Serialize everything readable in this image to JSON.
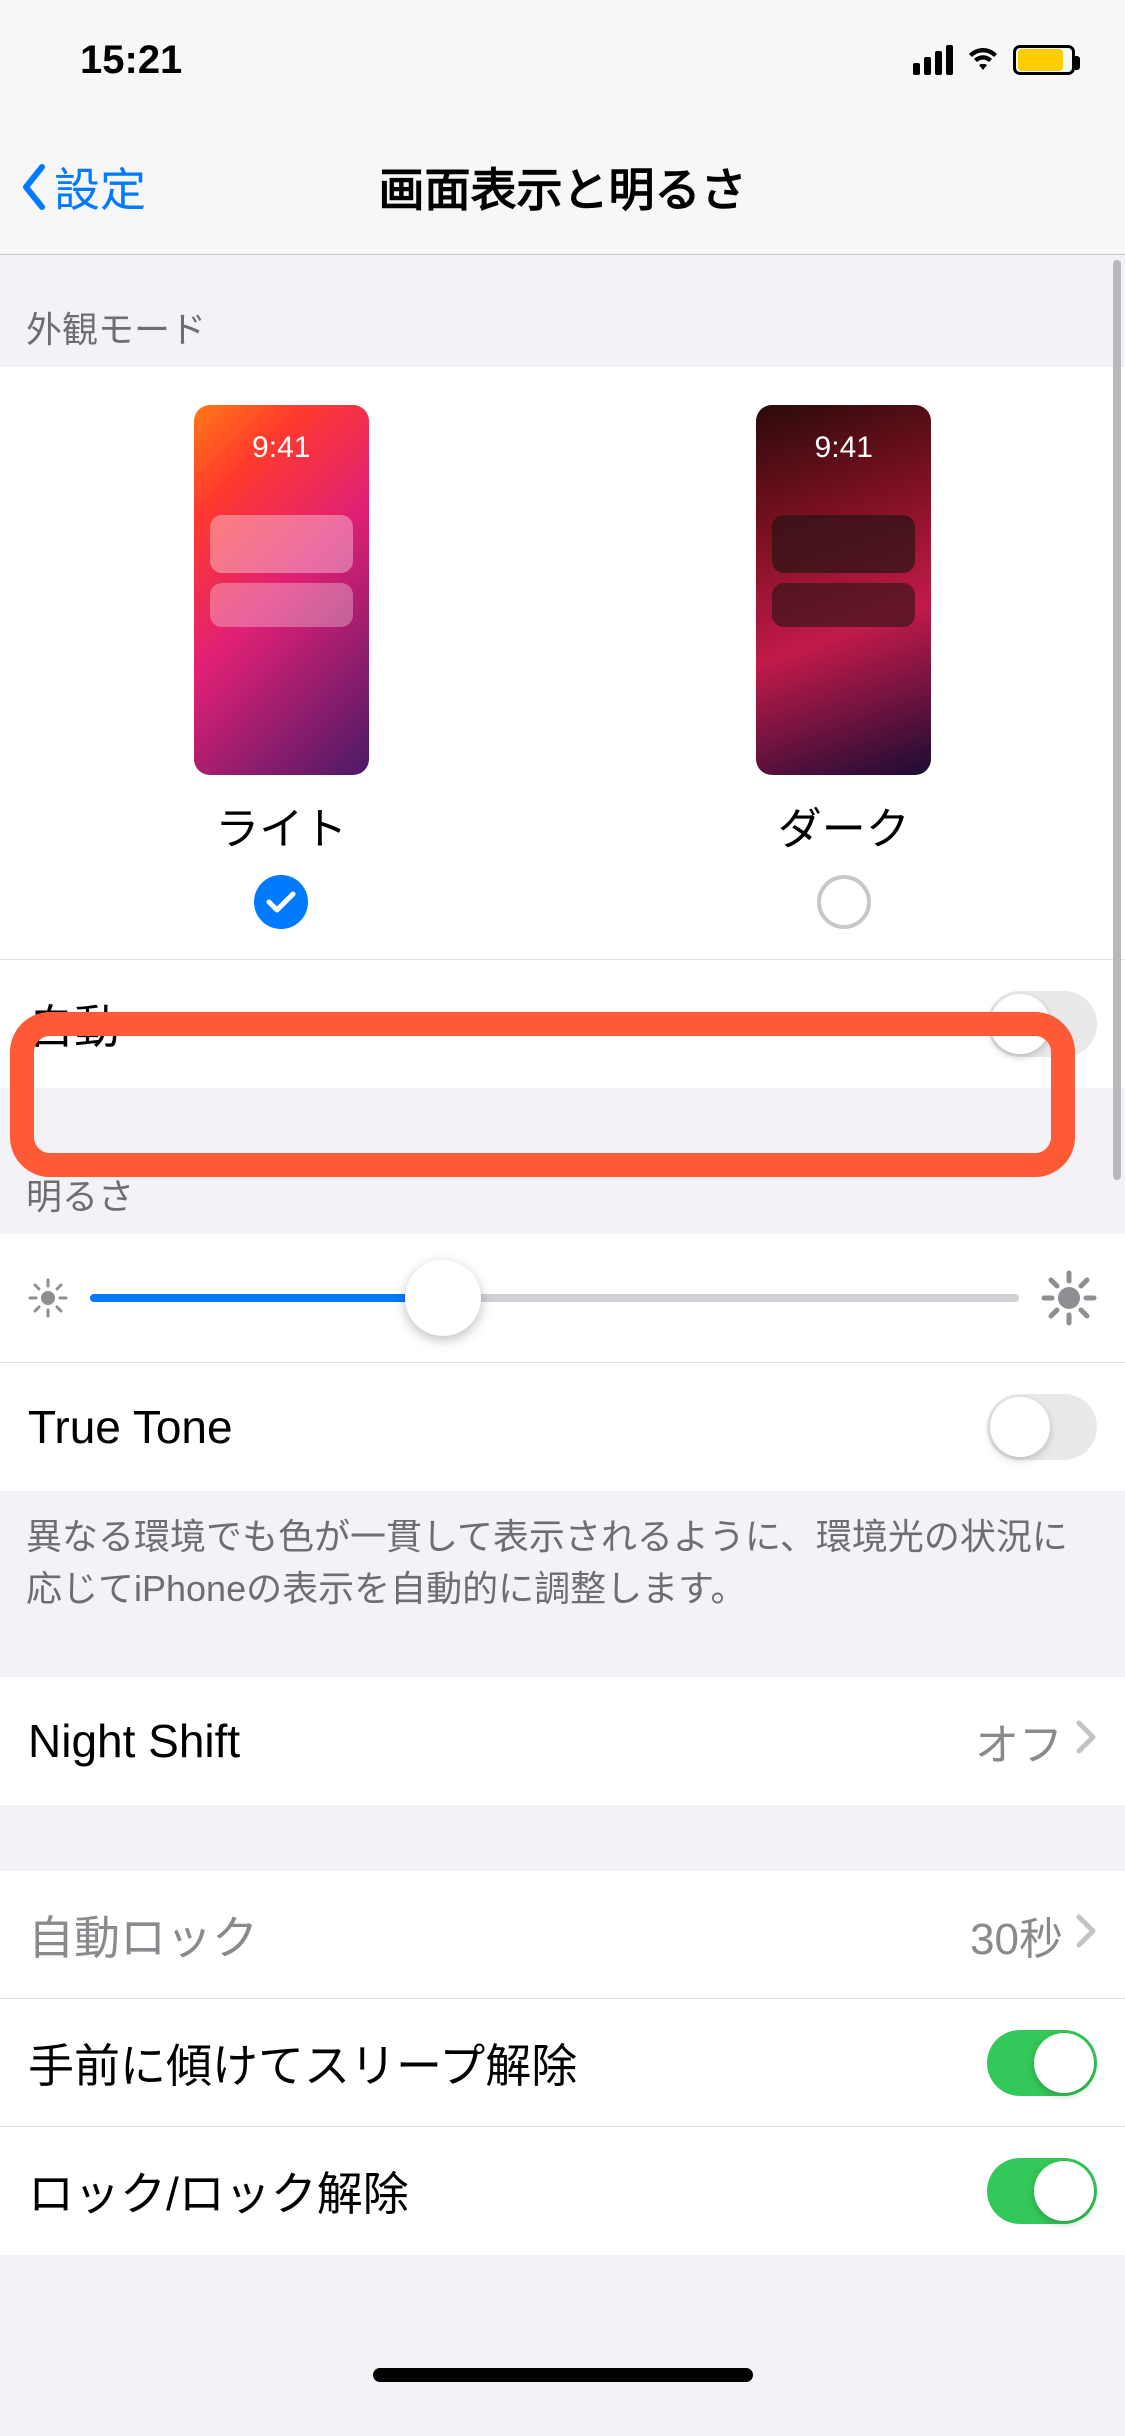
{
  "status": {
    "time": "15:21",
    "battery_percent": 80
  },
  "nav": {
    "back_label": "設定",
    "title": "画面表示と明るさ"
  },
  "appearance": {
    "header": "外観モード",
    "preview_time": "9:41",
    "options": [
      {
        "label": "ライト",
        "selected": true
      },
      {
        "label": "ダーク",
        "selected": false
      }
    ],
    "auto_label": "自動",
    "auto_on": false
  },
  "brightness": {
    "header": "明るさ",
    "value_percent": 38,
    "true_tone_label": "True Tone",
    "true_tone_on": false,
    "true_tone_footer": "異なる環境でも色が一貫して表示されるように、環境光の状況に応じてiPhoneの表示を自動的に調整します。"
  },
  "night_shift": {
    "label": "Night Shift",
    "value": "オフ"
  },
  "lock": {
    "auto_lock_label": "自動ロック",
    "auto_lock_value": "30秒",
    "raise_to_wake_label": "手前に傾けてスリープ解除",
    "raise_to_wake_on": true,
    "lock_unlock_label": "ロック/ロック解除",
    "lock_unlock_on": true
  }
}
